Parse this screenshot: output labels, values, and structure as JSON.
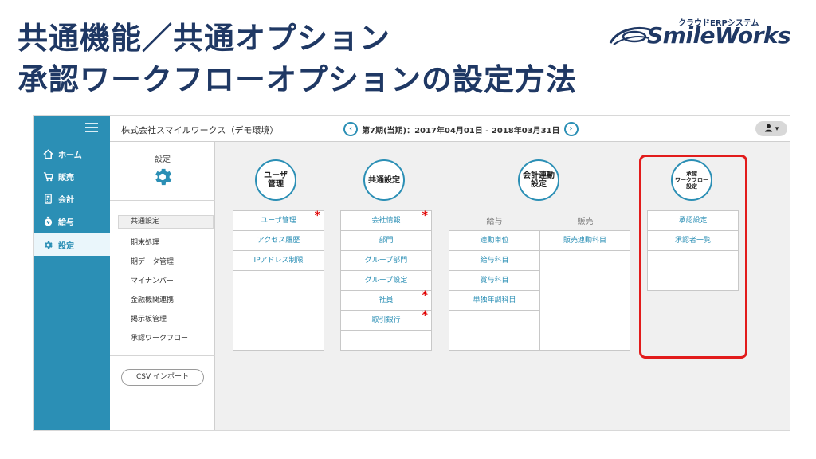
{
  "slide": {
    "title_line1": "共通機能／共通オプション",
    "title_line2": "承認ワークフローオプションの設定方法"
  },
  "logo": {
    "subtitle": "クラウドERPシステム",
    "name": "SmileWorks",
    "brand_color": "#1f3864"
  },
  "colors": {
    "accent": "#2b8fb5",
    "required": "#e00000",
    "highlight": "#e21b1b"
  },
  "sidebar": {
    "menu_icon": "hamburger-icon",
    "items": [
      {
        "label": "ホーム",
        "icon": "home-icon"
      },
      {
        "label": "販売",
        "icon": "cart-icon"
      },
      {
        "label": "会計",
        "icon": "calculator-icon"
      },
      {
        "label": "給与",
        "icon": "money-bag-icon"
      },
      {
        "label": "設定",
        "icon": "gear-icon",
        "active": true
      }
    ]
  },
  "topbar": {
    "company": "株式会社スマイルワークス（デモ環境）",
    "period": "第7期(当期)：2017年04月01日 - 2018年03月31日",
    "prev_icon": "chevron-left-icon",
    "next_icon": "chevron-right-icon",
    "user_icon": "user-icon",
    "user_caret": "▾"
  },
  "subpanel": {
    "title": "設定",
    "items": [
      "共通設定",
      "期末処理",
      "期データ管理",
      "マイナンバー",
      "金融機関連携",
      "掲示板管理",
      "承認ワークフロー"
    ],
    "csv_button": "CSV インポート"
  },
  "sections": {
    "user": {
      "head_line1": "ユーザ",
      "head_line2": "管理",
      "items": [
        "ユーザ管理",
        "アクセス履歴",
        "IPアドレス制限"
      ]
    },
    "common": {
      "head": "共通設定",
      "items": [
        "会社情報",
        "部門",
        "グループ部門",
        "グループ設定",
        "社員",
        "取引銀行"
      ]
    },
    "integration": {
      "head_line1": "会計連動",
      "head_line2": "設定",
      "col_payroll": "給与",
      "col_sales": "販売",
      "payroll_items": [
        "連動単位",
        "給与科目",
        "賞与科目",
        "単独年調科目"
      ],
      "sales_items": [
        "販売連動科目"
      ]
    },
    "workflow": {
      "head_line1": "承認",
      "head_line2": "ワークフロー",
      "head_line3": "設定",
      "items": [
        "承認設定",
        "承認者一覧"
      ]
    }
  },
  "required_mark": "*"
}
